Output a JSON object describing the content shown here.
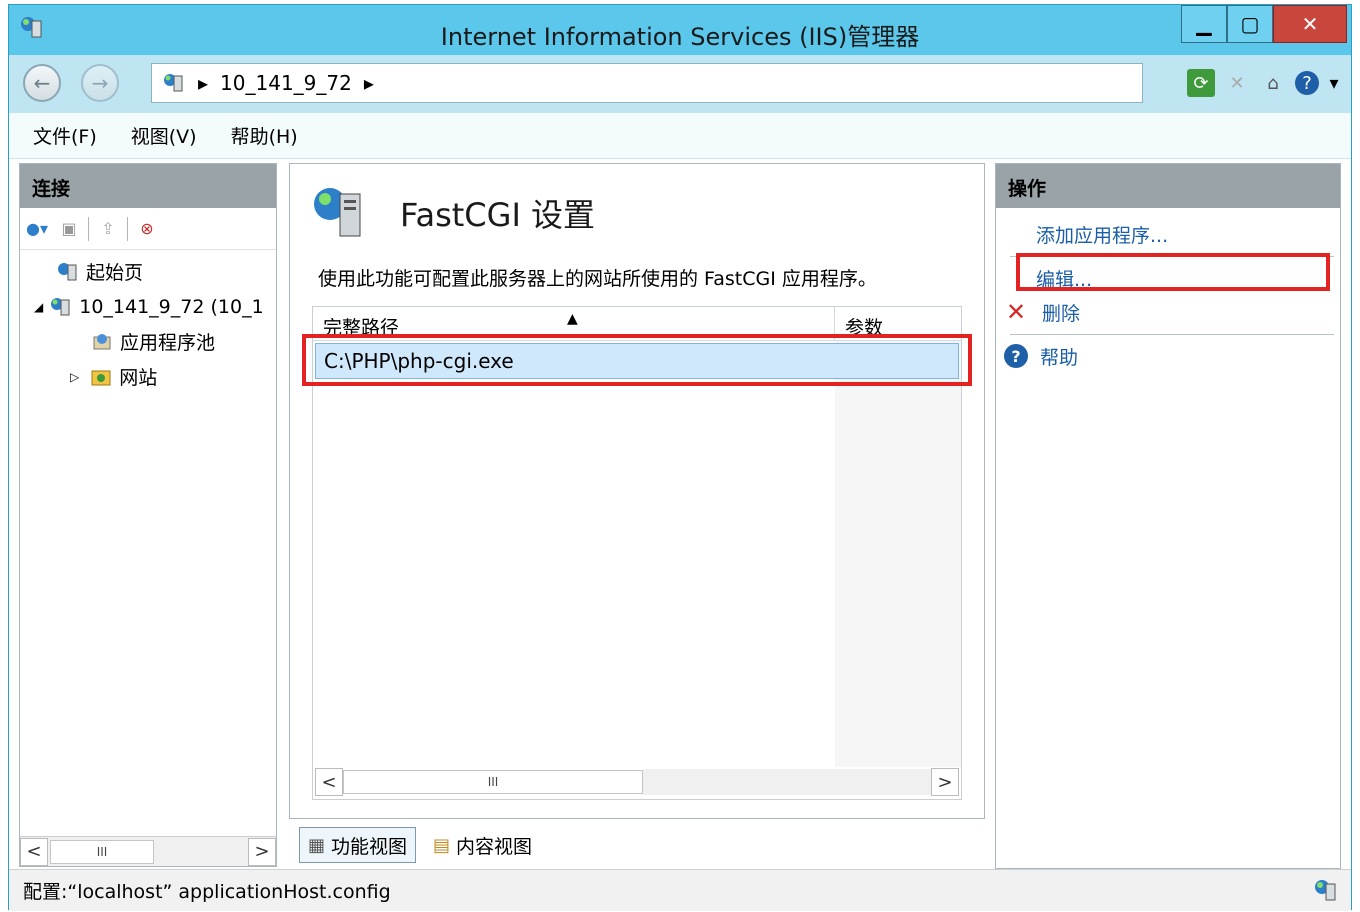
{
  "window": {
    "title": "Internet Information Services (IIS)管理器"
  },
  "address": {
    "segments": [
      "10_141_9_72"
    ]
  },
  "menu": {
    "items": [
      "文件(F)",
      "视图(V)",
      "帮助(H)"
    ]
  },
  "connections": {
    "title": "连接",
    "tree": [
      {
        "label": "起始页"
      },
      {
        "label": "10_141_9_72 (10_1"
      },
      {
        "label": "应用程序池"
      },
      {
        "label": "网站"
      }
    ],
    "scroll_label": "III"
  },
  "main": {
    "title": "FastCGI 设置",
    "description": "使用此功能可配置此服务器上的网站所使用的 FastCGI 应用程序。",
    "columns": [
      "完整路径",
      "参数"
    ],
    "rows": [
      {
        "path": "C:\\PHP\\php-cgi.exe",
        "args": ""
      }
    ],
    "scroll_label": "III"
  },
  "view_tabs": [
    "功能视图",
    "内容视图"
  ],
  "actions": {
    "title": "操作",
    "items": [
      "添加应用程序...",
      "编辑...",
      "删除",
      "帮助"
    ]
  },
  "status": {
    "text": "配置:“localhost” applicationHost.config"
  },
  "colors": {
    "highlight": "#e32222",
    "link": "#1a5ea8",
    "title_bar": "#5bc8eb"
  }
}
